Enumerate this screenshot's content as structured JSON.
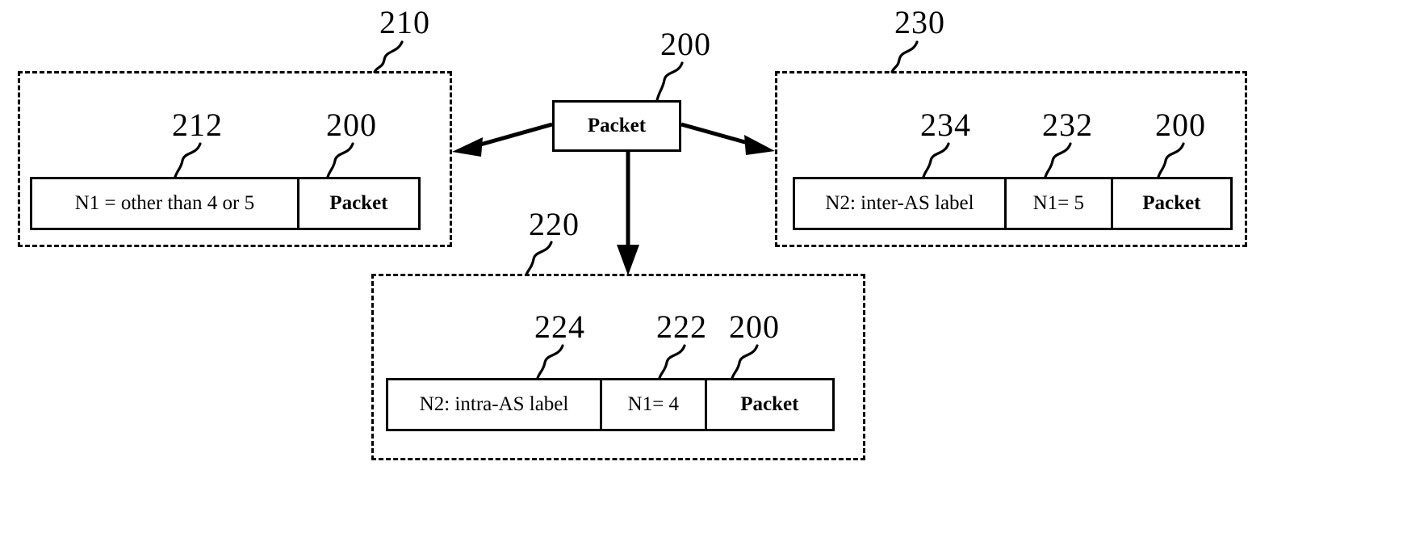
{
  "figure": {
    "type": "patent-diagram",
    "background_color": "#ffffff",
    "line_color": "#000000"
  },
  "source_node": {
    "label": "Packet",
    "ref": "200"
  },
  "branches": [
    {
      "id": "left",
      "ref": "210",
      "strip": {
        "fields": [
          {
            "text": "N1 = other than 4 or 5",
            "ref": "212",
            "bold": false
          },
          {
            "text": "Packet",
            "ref": "200",
            "bold": true
          }
        ]
      }
    },
    {
      "id": "bottom",
      "ref": "220",
      "strip": {
        "fields": [
          {
            "text": "N2: intra-AS label",
            "ref": "224",
            "bold": false
          },
          {
            "text": "N1= 4",
            "ref": "222",
            "bold": false
          },
          {
            "text": "Packet",
            "ref": "200",
            "bold": true
          }
        ]
      }
    },
    {
      "id": "right",
      "ref": "230",
      "strip": {
        "fields": [
          {
            "text": "N2: inter-AS label",
            "ref": "234",
            "bold": false
          },
          {
            "text": "N1= 5",
            "ref": "232",
            "bold": false
          },
          {
            "text": "Packet",
            "ref": "200",
            "bold": true
          }
        ]
      }
    }
  ],
  "refs": {
    "r210": "210",
    "r212": "212",
    "r200_left": "200",
    "r200_center": "200",
    "r220": "220",
    "r224": "224",
    "r222": "222",
    "r200_bottom": "200",
    "r230": "230",
    "r234": "234",
    "r232": "232",
    "r200_right": "200"
  },
  "labels": {
    "packet_center": "Packet",
    "left_field_1": "N1 = other than 4 or 5",
    "left_field_2": "Packet",
    "bottom_field_1": "N2: intra-AS label",
    "bottom_field_2": "N1= 4",
    "bottom_field_3": "Packet",
    "right_field_1": "N2: inter-AS label",
    "right_field_2": "N1= 5",
    "right_field_3": "Packet"
  }
}
